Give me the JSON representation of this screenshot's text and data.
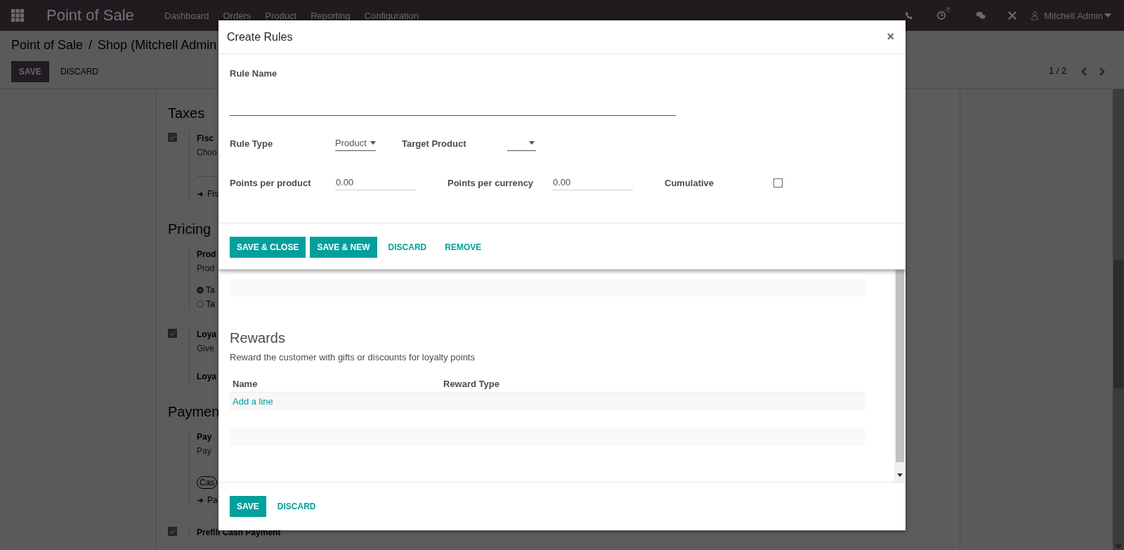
{
  "navbar": {
    "app_title": "Point of Sale",
    "menu": [
      "Dashboard",
      "Orders",
      "Product",
      "Reporting",
      "Configuration"
    ],
    "activity_badge": "7",
    "user": "Mitchell Admin"
  },
  "control_panel": {
    "breadcrumb": [
      "Point of Sale",
      "Shop (Mitchell Admin"
    ],
    "separator": "/",
    "buttons": [
      "SAVE",
      "DISCARD"
    ],
    "pager": "1 / 2"
  },
  "settings_form": {
    "sections": [
      {
        "title": "Taxes",
        "settings": [
          {
            "kind": "checkbox",
            "checked": true,
            "label": "Fisc",
            "description": "Choo",
            "link": "Fis"
          }
        ]
      },
      {
        "title": "Pricing",
        "settings": [
          {
            "kind": "radio",
            "label": "Prod",
            "description": "Prod",
            "options": [
              {
                "label": "Ta",
                "selected": true
              },
              {
                "label": "Ta",
                "selected": false
              }
            ]
          },
          {
            "kind": "checkbox",
            "checked": true,
            "label": "Loya",
            "description": "Give",
            "sublabel": "Loya"
          }
        ]
      },
      {
        "title": "Paymen",
        "settings": [
          {
            "kind": "tags",
            "label": "Pay",
            "description": "Pay",
            "tags": [
              "Cas"
            ],
            "link": "Pa"
          },
          {
            "kind": "checkbox",
            "checked": true,
            "label": "Prefill Cash Payment"
          }
        ]
      }
    ]
  },
  "program_dialog": {
    "section_title": "Rewards",
    "section_description": "Reward the customer with gifts or discounts for loyalty points",
    "columns": [
      "Name",
      "Reward Type"
    ],
    "add_line": "Add a line",
    "buttons": [
      {
        "label": "SAVE",
        "kind": "primary"
      },
      {
        "label": "DISCARD",
        "kind": "link"
      }
    ]
  },
  "rule_dialog": {
    "title": "Create Rules",
    "close": "×",
    "rule_name_label": "Rule Name",
    "rule_type": {
      "label": "Rule Type",
      "value": "Product"
    },
    "target_product": {
      "label": "Target Product"
    },
    "points_per_product": {
      "label": "Points per product",
      "value": "0.00"
    },
    "points_per_currency": {
      "label": "Points per currency",
      "value": "0.00"
    },
    "cumulative": {
      "label": "Cumulative",
      "checked": false
    },
    "buttons": [
      {
        "label": "SAVE & CLOSE",
        "kind": "primary"
      },
      {
        "label": "SAVE & NEW",
        "kind": "primary"
      },
      {
        "label": "DISCARD",
        "kind": "link"
      },
      {
        "label": "REMOVE",
        "kind": "link"
      }
    ]
  }
}
